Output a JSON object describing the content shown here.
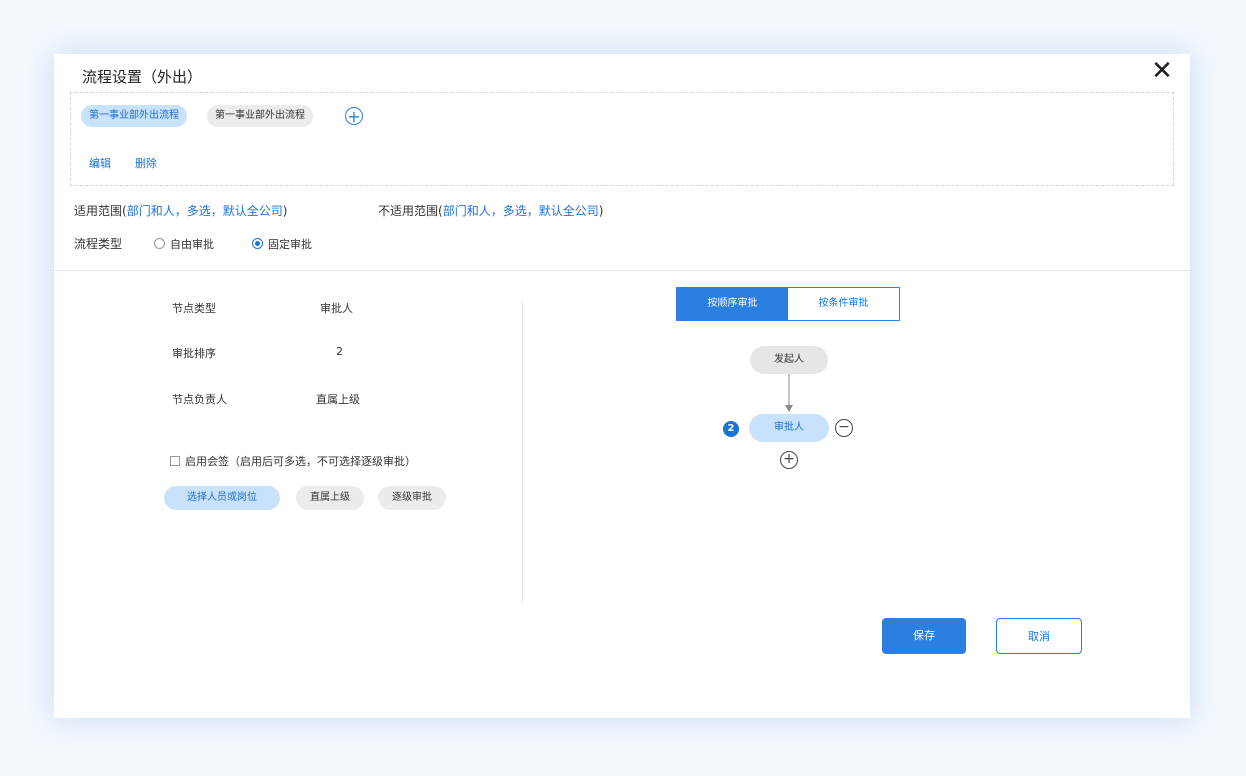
{
  "dialog": {
    "title": "流程设置（外出）",
    "close_label": "✕"
  },
  "flows": {
    "tabs": [
      "第一事业部外出流程",
      "第一事业部外出流程"
    ],
    "add_icon": "plus-circle-icon",
    "edit_label": "编辑",
    "delete_label": "删除"
  },
  "scope": {
    "applicable_label": "适用范围",
    "applicable_value": "部门和人，多选，默认全公司",
    "not_applicable_label": "不适用范围",
    "not_applicable_value": "部门和人，多选，默认全公司",
    "open_bracket": "(",
    "close_bracket": ")"
  },
  "process_type": {
    "label": "流程类型",
    "options": [
      "自由审批",
      "固定审批"
    ],
    "selected": "固定审批"
  },
  "node_settings": {
    "node_type_label": "节点类型",
    "node_type_value": "审批人",
    "order_label": "审批排序",
    "order_value": "2",
    "owner_label": "节点负责人",
    "owner_value": "直属上级",
    "countersign_label": "启用会签（启用后可多选，不可选择逐级审批）",
    "choices": [
      "选择人员或岗位",
      "直属上级",
      "逐级审批"
    ]
  },
  "approval_mode": {
    "options": [
      "按顺序审批",
      "按条件审批"
    ],
    "selected": "按顺序审批"
  },
  "flow_diagram": {
    "start_node": "发起人",
    "approver_node": "审批人",
    "approver_index": "2"
  },
  "footer": {
    "save_label": "保存",
    "cancel_label": "取消"
  },
  "colors": {
    "accent": "#2a7fe0",
    "chip_active": "#c9e2fb",
    "link": "#1a73d9"
  }
}
